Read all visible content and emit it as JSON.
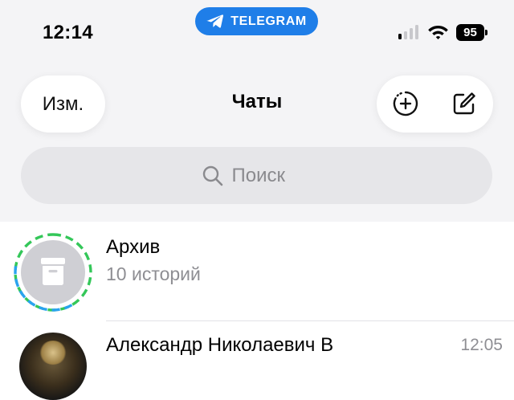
{
  "status_bar": {
    "time": "12:14",
    "app_pill_label": "TELEGRAM",
    "battery": "95",
    "signal_bars_active": 1,
    "signal_bars_total": 4
  },
  "header": {
    "edit_label": "Изм.",
    "title": "Чаты",
    "new_story_icon": "add-circle-dashed-icon",
    "compose_icon": "compose-icon"
  },
  "search": {
    "placeholder": "Поиск",
    "value": ""
  },
  "chats": {
    "archive": {
      "title": "Архив",
      "subtitle": "10 историй",
      "icon": "archive-box-icon"
    },
    "items": [
      {
        "name": "Александр Николаевич В",
        "time": "12:05"
      }
    ]
  },
  "colors": {
    "accent": "#1f7ee8",
    "header_bg": "#f4f4f6",
    "search_bg": "#e6e6e9",
    "secondary_text": "#8e8e93",
    "story_ring_seen": "#34c759",
    "story_ring_new": "#2aa3ef"
  }
}
